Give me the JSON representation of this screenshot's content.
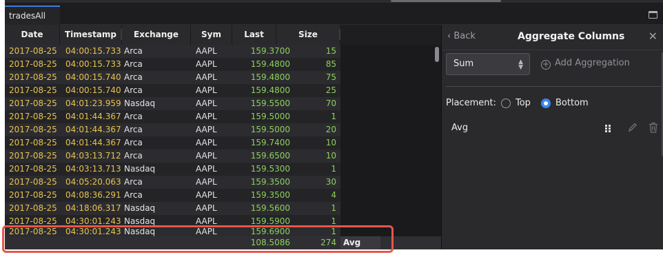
{
  "tab": {
    "label": "tradesAll"
  },
  "columns": [
    "Date",
    "Timestamp",
    "Exchange",
    "Sym",
    "Last",
    "Size"
  ],
  "rows": [
    [
      "2017-08-25",
      "04:00:15.733",
      "Arca",
      "AAPL",
      "159.3700",
      "15"
    ],
    [
      "2017-08-25",
      "04:00:15.733",
      "Arca",
      "AAPL",
      "159.4800",
      "85"
    ],
    [
      "2017-08-25",
      "04:00:15.740",
      "Arca",
      "AAPL",
      "159.4800",
      "75"
    ],
    [
      "2017-08-25",
      "04:00:15.740",
      "Arca",
      "AAPL",
      "159.4800",
      "25"
    ],
    [
      "2017-08-25",
      "04:01:23.959",
      "Nasdaq",
      "AAPL",
      "159.5500",
      "70"
    ],
    [
      "2017-08-25",
      "04:01:44.367",
      "Arca",
      "AAPL",
      "159.5000",
      "1"
    ],
    [
      "2017-08-25",
      "04:01:44.367",
      "Arca",
      "AAPL",
      "159.5000",
      "20"
    ],
    [
      "2017-08-25",
      "04:01:44.367",
      "Arca",
      "AAPL",
      "159.7400",
      "10"
    ],
    [
      "2017-08-25",
      "04:03:13.712",
      "Arca",
      "AAPL",
      "159.6500",
      "10"
    ],
    [
      "2017-08-25",
      "04:03:13.713",
      "Nasdaq",
      "AAPL",
      "159.5300",
      "1"
    ],
    [
      "2017-08-25",
      "04:05:20.063",
      "Arca",
      "AAPL",
      "159.3500",
      "30"
    ],
    [
      "2017-08-25",
      "04:08:36.291",
      "Arca",
      "AAPL",
      "159.3500",
      "4"
    ],
    [
      "2017-08-25",
      "04:18:06.317",
      "Nasdaq",
      "AAPL",
      "159.5600",
      "1"
    ],
    [
      "2017-08-25",
      "04:30:01.243",
      "Nasdaq",
      "AAPL",
      "159.5900",
      "1"
    ],
    [
      "2017-08-25",
      "04:30:01.243",
      "Nasdaq",
      "AAPL",
      "159.6900",
      "1"
    ]
  ],
  "footer": {
    "last": "108.5086",
    "size": "274",
    "label": "Avg"
  },
  "panel": {
    "back_label": "Back",
    "title": "Aggregate Columns",
    "select_value": "Sum",
    "add_label": "Add Aggregation",
    "placement_label": "Placement:",
    "option_top": "Top",
    "option_bottom": "Bottom",
    "selected_placement": "Bottom",
    "aggregations": [
      "Avg"
    ]
  },
  "colors": {
    "date_time": "#e7c34f",
    "numeric": "#8ed05c",
    "accent": "#3b86ee",
    "highlight": "#e6574a"
  },
  "icons": [
    "chevron-left-icon",
    "close-icon",
    "updown-arrows-icon",
    "plus-circle-icon",
    "drag-handle-icon",
    "pencil-icon",
    "trash-icon",
    "maximize-icon"
  ]
}
